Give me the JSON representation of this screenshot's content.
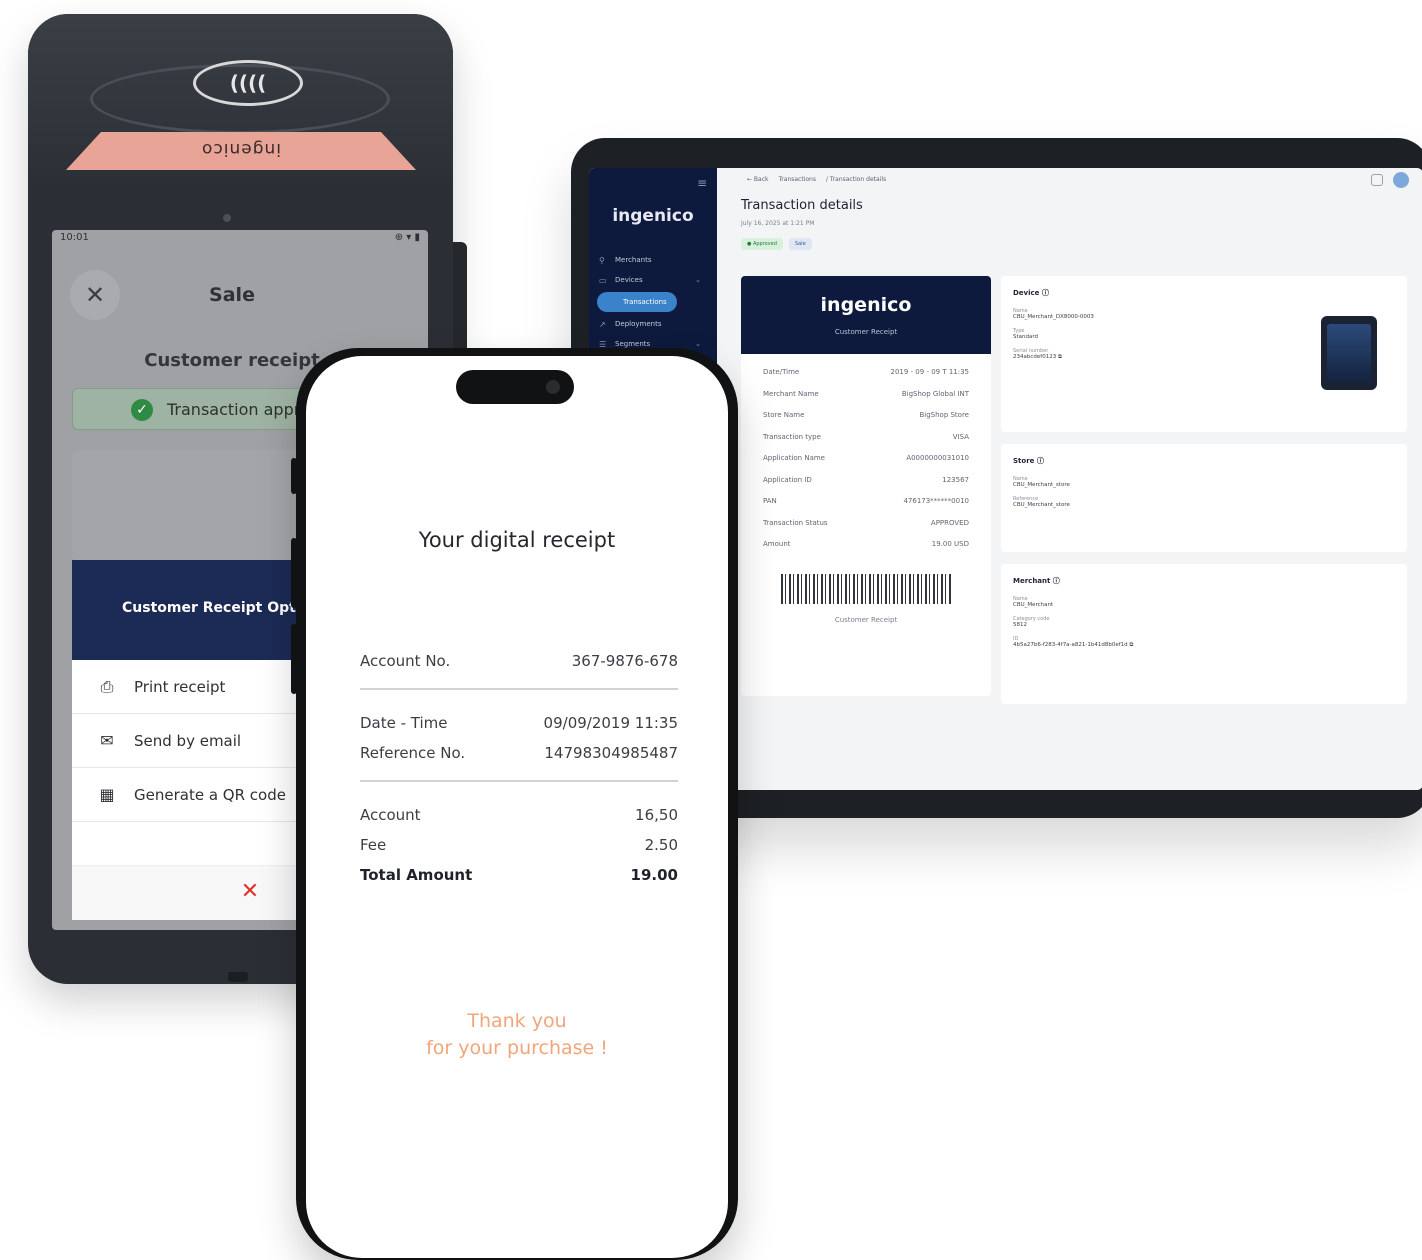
{
  "pos": {
    "brand": "ingenico",
    "nfc_symbol": "((((",
    "status_time": "10:01",
    "status_icons_right": "⊕ ▾ ▮",
    "title": "Sale",
    "subtitle": "Customer receipt",
    "approved_text": "Transaction appr",
    "sheet_title": "Customer Receipt Optic",
    "options": [
      {
        "icon": "printer",
        "label": "Print receipt"
      },
      {
        "icon": "envelope",
        "label": "Send by email"
      },
      {
        "icon": "qr",
        "label": "Generate a QR code"
      }
    ],
    "cancel_symbol": "✕"
  },
  "tablet": {
    "logo": "ingenico",
    "nav": [
      "Merchants",
      "Devices",
      "Transactions",
      "Deployments",
      "Segments"
    ],
    "breadcrumb": [
      "← Back",
      "Transactions",
      "/ Transaction details"
    ],
    "title": "Transaction details",
    "date": "July 16, 2025 at 1:21 PM",
    "badges": [
      "● Approved",
      "Sale"
    ],
    "receipt": {
      "logo": "ingenico",
      "subtitle": "Customer Receipt",
      "rows": [
        [
          "Date/Time",
          "2019 - 09 - 09 T 11:35"
        ],
        [
          "Merchant Name",
          "BigShop Global INT"
        ],
        [
          "Store Name",
          "BigShop Store"
        ],
        [
          "Transaction type",
          "VISA"
        ],
        [
          "Application Name",
          "A0000000031010"
        ],
        [
          "Application ID",
          "123567"
        ],
        [
          "PAN",
          "476173******0010"
        ],
        [
          "Transaction Status",
          "APPROVED"
        ],
        [
          "Amount",
          "19.00 USD"
        ]
      ],
      "barcode_label": "Customer Receipt"
    },
    "device": {
      "title": "Device ⓘ",
      "fields": [
        [
          "Name",
          "CBU_Merchant_DX8000-0003"
        ],
        [
          "Type",
          "Standard"
        ],
        [
          "Serial number",
          "234abcdef0123 ⧉"
        ]
      ]
    },
    "store": {
      "title": "Store ⓘ",
      "fields": [
        [
          "Name",
          "CBU_Merchant_store"
        ],
        [
          "Reference",
          "CBU_Merchant_store"
        ]
      ]
    },
    "merchant": {
      "title": "Merchant ⓘ",
      "fields": [
        [
          "Name",
          "CBU_Merchant"
        ],
        [
          "Category code",
          "5812"
        ],
        [
          "ID",
          "4b5a27b6-f283-4f7a-a821-1b41d8b0ef1d ⧉"
        ]
      ]
    }
  },
  "phone": {
    "title": "Your digital receipt",
    "group1": [
      [
        "Account No.",
        "367-9876-678"
      ]
    ],
    "group2": [
      [
        "Date - Time",
        "09/09/2019 11:35"
      ],
      [
        "Reference No.",
        "14798304985487"
      ]
    ],
    "group3": [
      [
        "Account",
        "16,50"
      ],
      [
        "Fee",
        "2.50"
      ]
    ],
    "total": [
      "Total Amount",
      "19.00"
    ],
    "thanks_line1": "Thank you",
    "thanks_line2": "for your purchase !"
  }
}
